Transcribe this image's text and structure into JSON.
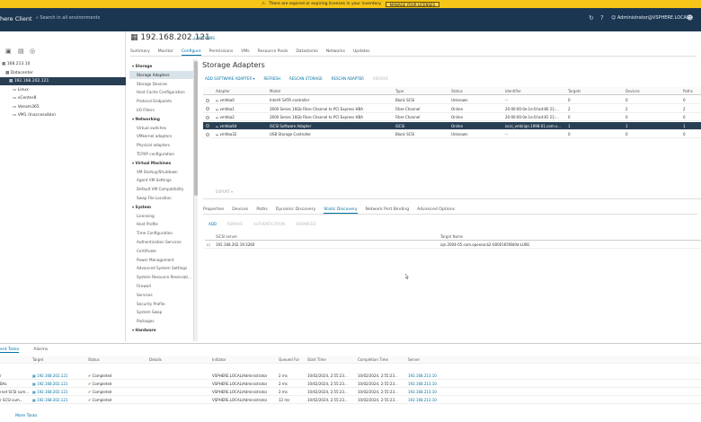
{
  "banner": {
    "text": "There are expired or expiring licenses in your inventory.",
    "button": "MANAGE YOUR LICENSES"
  },
  "topbar": {
    "title": "here Client",
    "search_placeholder": "Search in all environments",
    "user": "Administrator@VSPHERE.LOCAL"
  },
  "tree": [
    {
      "label": "168.213.10",
      "indent": 0,
      "selected": false
    },
    {
      "label": "Datacenter",
      "indent": 4,
      "selected": false
    },
    {
      "label": "192.168.202.121",
      "indent": 8,
      "selected": true
    },
    {
      "label": "Linux",
      "indent": 12,
      "selected": false
    },
    {
      "label": "vCenter8",
      "indent": 12,
      "selected": false
    },
    {
      "label": "Veeam365",
      "indent": 12,
      "selected": false
    },
    {
      "label": "VM1 (Inaccessible)",
      "indent": 12,
      "selected": false
    }
  ],
  "object": {
    "title": "192.168.202.121",
    "actions": "ACTIONS"
  },
  "tabs": [
    "Summary",
    "Monitor",
    "Configure",
    "Permissions",
    "VMs",
    "Resource Pools",
    "Datastores",
    "Networks",
    "Updates"
  ],
  "active_tab": "Configure",
  "cfg_nav": [
    {
      "label": "Storage",
      "section": true
    },
    {
      "label": "Storage Adapters",
      "selected": true
    },
    {
      "label": "Storage Devices"
    },
    {
      "label": "Host Cache Configuration"
    },
    {
      "label": "Protocol Endpoints"
    },
    {
      "label": "I/O Filters"
    },
    {
      "label": "Networking",
      "section": true
    },
    {
      "label": "Virtual switches"
    },
    {
      "label": "VMkernel adapters"
    },
    {
      "label": "Physical adapters"
    },
    {
      "label": "TCP/IP configuration"
    },
    {
      "label": "Virtual Machines",
      "section": true
    },
    {
      "label": "VM Startup/Shutdown"
    },
    {
      "label": "Agent VM Settings"
    },
    {
      "label": "Default VM Compatibility"
    },
    {
      "label": "Swap File Location"
    },
    {
      "label": "System",
      "section": true
    },
    {
      "label": "Licensing"
    },
    {
      "label": "Host Profile"
    },
    {
      "label": "Time Configuration"
    },
    {
      "label": "Authentication Services"
    },
    {
      "label": "Certificate"
    },
    {
      "label": "Power Management"
    },
    {
      "label": "Advanced System Settings"
    },
    {
      "label": "System Resource Reservati..."
    },
    {
      "label": "Firewall"
    },
    {
      "label": "Services"
    },
    {
      "label": "Security Profile"
    },
    {
      "label": "System Swap"
    },
    {
      "label": "Packages"
    },
    {
      "label": "Hardware",
      "section": true
    }
  ],
  "content_title": "Storage Adapters",
  "actionbar": {
    "add": "ADD SOFTWARE ADAPTER ▾",
    "refresh": "REFRESH",
    "rescan_storage": "RESCAN STORAGE",
    "rescan_adapter": "RESCAN ADAPTER",
    "remove": "REMOVE"
  },
  "adapters": {
    "headers": [
      "Adapter",
      "Model",
      "Type",
      "Status",
      "Identifier",
      "Targets",
      "Devices",
      "Paths"
    ],
    "rows": [
      [
        "vmhba0",
        "Intel® SATA controller",
        "Block SCSI",
        "Unknown",
        "--",
        "0",
        "0",
        "0"
      ],
      [
        "vmhba1",
        "2600 Series 16Gb Fibre Channel to PCI Express HBA",
        "Fibre Channel",
        "Online",
        "20:00:00:0e:1e:0l:ad:80 21:...",
        "2",
        "2",
        "2"
      ],
      [
        "vmhba2",
        "2600 Series 16Gb Fibre Channel to PCI Express HBA",
        "Fibre Channel",
        "Online",
        "20:00:00:0e:1e:0l:ad:81 21:...",
        "0",
        "0",
        "0"
      ],
      [
        "vmhba64",
        "iSCSI Software Adapter",
        "iSCSI",
        "Online",
        "iscsi_vmk(iqn.1998-01.com.v...",
        "1",
        "1",
        "1"
      ],
      [
        "vmhba32",
        "USB Storage Controller",
        "Block SCSI",
        "Unknown",
        "--",
        "0",
        "0",
        "0"
      ]
    ],
    "selected_index": 3
  },
  "export_label": "EXPORT ▾",
  "detail_tabs": [
    "Properties",
    "Devices",
    "Paths",
    "Dynamic Discovery",
    "Static Discovery",
    "Network Port Binding",
    "Advanced Options"
  ],
  "active_detail_tab": "Static Discovery",
  "detail_actions": {
    "add": "ADD",
    "remove": "REMOVE",
    "auth": "AUTHENTICATION",
    "advanced": "ADVANCED"
  },
  "static": {
    "headers": [
      "iSCSI server",
      "Target Name"
    ],
    "rows": [
      [
        "192.168.202.19:3260",
        "iqn.2004-05.com.openeo:b2-0000165f8d0d-LUN1"
      ]
    ]
  },
  "tasks": {
    "tabs": [
      "ent Tasks",
      "Alarms"
    ],
    "headers": [
      "",
      "Target",
      "Status",
      "Details",
      "Initiator",
      "Queued For",
      "Start Time",
      "Completion Time",
      "Server"
    ],
    "rows": [
      [
        "r",
        "192.168.202.121",
        "Completed",
        "",
        "VSPHERE.LOCAL\\Administrator",
        "2 ms",
        "10/02/2024, 2:55:23...",
        "10/02/2024, 2:55:23...",
        "192.168.213.10"
      ],
      [
        "BAs",
        "192.168.202.121",
        "Completed",
        "",
        "VSPHERE.LOCAL\\Administrator",
        "2 ms",
        "10/02/2024, 2:55:23...",
        "10/02/2024, 2:55:23...",
        "192.168.213.10"
      ],
      [
        "rnet SCSI sum...",
        "192.168.202.121",
        "Completed",
        "",
        "VSPHERE.LOCAL\\Administrator",
        "2 ms",
        "10/02/2024, 2:55:23...",
        "10/02/2024, 2:55:23...",
        "192.168.213.10"
      ],
      [
        "r SCSI sum...",
        "192.168.202.121",
        "Completed",
        "",
        "VSPHERE.LOCAL\\Administrator",
        "12 ms",
        "10/02/2024, 2:55:23...",
        "10/02/2024, 2:55:23...",
        "192.168.213.10"
      ]
    ],
    "more": "More Tasks"
  },
  "colors": {
    "banner": "#f5c518",
    "header": "#1b3651",
    "selected_row": "#283e53",
    "link": "#0072a3"
  }
}
